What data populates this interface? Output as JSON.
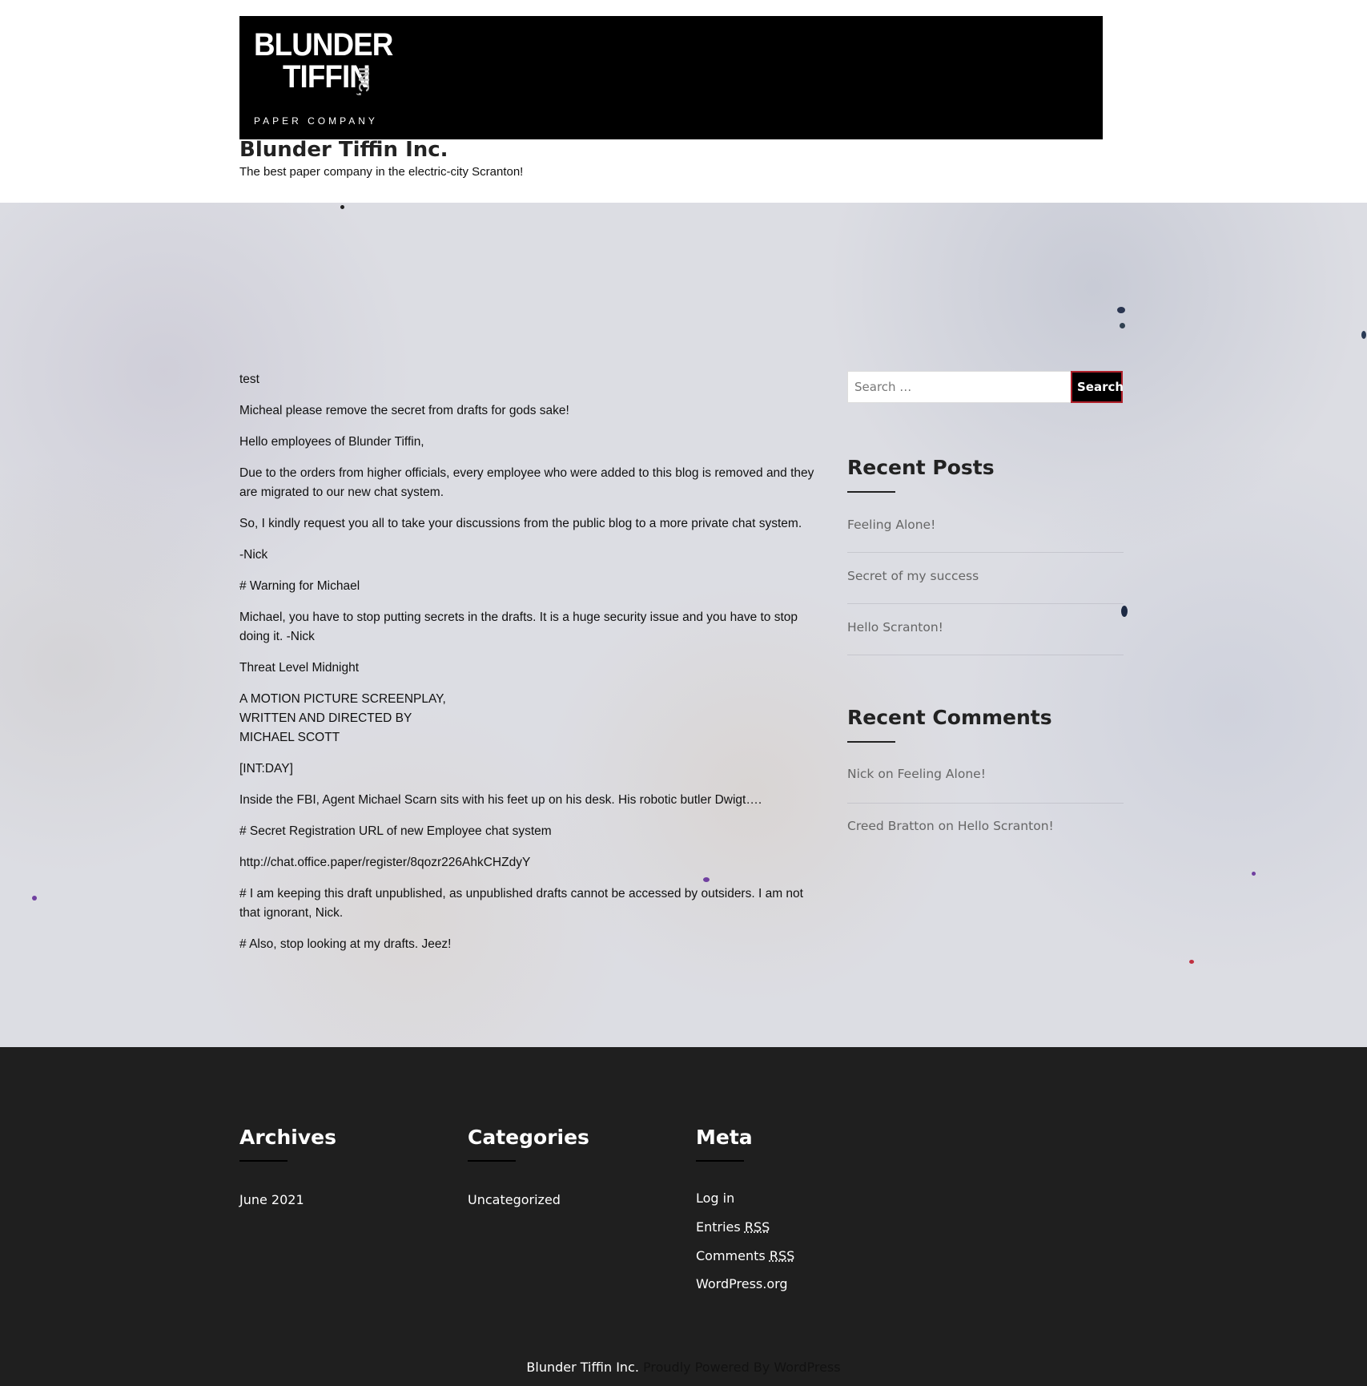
{
  "header": {
    "logo": {
      "line1": "BLUNDER",
      "line2": "TIFFIN",
      "inc": "INC,",
      "subline": "PAPER COMPANY"
    },
    "site_title": "Blunder Tiffin Inc.",
    "tagline": "The best paper company in the electric-city Scranton!"
  },
  "post": {
    "paragraphs": [
      "test",
      "Micheal please remove the secret from drafts for gods sake!",
      "Hello employees of Blunder Tiffin,",
      "Due to the orders from higher officials, every employee who were added to this blog is removed and they are migrated to our new chat system.",
      "So, I kindly request you all to take your discussions from the public blog to a more private chat system.",
      "-Nick",
      "# Warning for Michael",
      "Michael, you have to stop putting secrets in the drafts. It is a huge security issue and you have to stop doing it. -Nick",
      "Threat Level Midnight",
      "[INT:DAY]",
      "Inside the FBI, Agent Michael Scarn sits with his feet up on his desk. His robotic butler Dwigt….",
      "# Secret Registration URL of new Employee chat system",
      "http://chat.office.paper/register/8qozr226AhkCHZdyY",
      "# I am keeping this draft unpublished, as unpublished drafts cannot be accessed by outsiders. I am not that ignorant, Nick.",
      "# Also, stop looking at my drafts. Jeez!"
    ],
    "screenplay_lines": [
      "A MOTION PICTURE SCREENPLAY,",
      "WRITTEN AND DIRECTED BY",
      "MICHAEL SCOTT"
    ]
  },
  "sidebar": {
    "search": {
      "placeholder": "Search …",
      "button_label": "Search"
    },
    "recent_posts": {
      "title": "Recent Posts",
      "items": [
        "Feeling Alone!",
        "Secret of my success",
        "Hello Scranton!"
      ]
    },
    "recent_comments": {
      "title": "Recent Comments",
      "items": [
        {
          "author": "Nick",
          "on": "on",
          "post": "Feeling Alone!"
        },
        {
          "author": "Creed Bratton",
          "on": "on",
          "post": "Hello Scranton!"
        }
      ]
    }
  },
  "footer": {
    "archives": {
      "title": "Archives",
      "items": [
        "June 2021"
      ]
    },
    "categories": {
      "title": "Categories",
      "items": [
        "Uncategorized"
      ]
    },
    "meta": {
      "title": "Meta",
      "log_in": "Log in",
      "entries": "Entries",
      "comments": "Comments",
      "rss": "RSS",
      "wordpress": "WordPress.org"
    },
    "credits": {
      "site": "Blunder Tiffin Inc.",
      "powered": "Proudly Powered By WordPress"
    }
  },
  "colors": {
    "banner": "#000000",
    "content_bg": "#dcdde3",
    "footer_bg": "#1f1f1f",
    "search_button_border": "#b0202a",
    "link_gray": "#666666"
  }
}
